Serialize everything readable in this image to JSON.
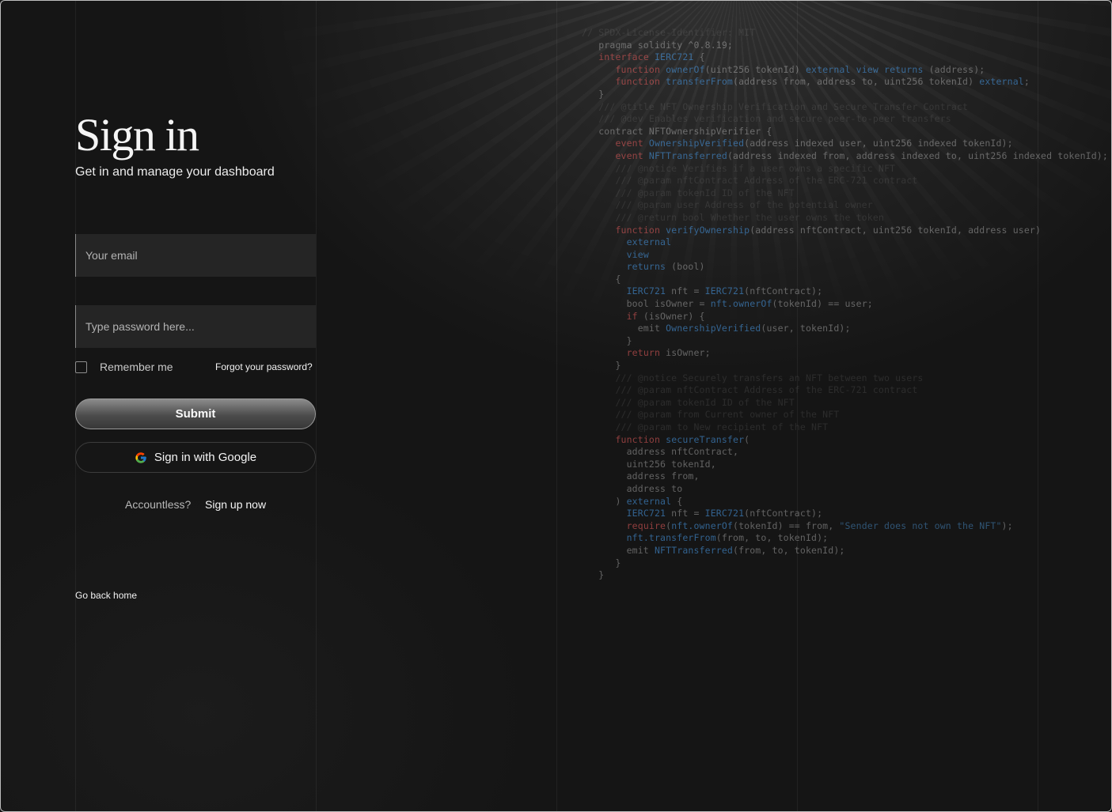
{
  "header": {
    "title": "Sign in",
    "subtitle": "Get in and manage your dashboard"
  },
  "form": {
    "email_placeholder": "Your email",
    "email_value": "",
    "password_placeholder": "Type password here...",
    "password_value": "",
    "remember_label": "Remember me",
    "remember_checked": false,
    "forgot_label": "Forgot your password?",
    "submit_label": "Submit",
    "google_label": "Sign in with Google",
    "google_icon": "google-g-icon"
  },
  "footer": {
    "account_prompt": "Accountless?",
    "signup_label": "Sign up now",
    "back_label": "Go back home"
  },
  "code_lines": [
    "// SPDX-License-Identifier: MIT",
    "pragma solidity ^0.8.19;",
    "interface IERC721 {",
    "function ownerOf(uint256 tokenId) external view returns (address);",
    "function transferFrom(address from, address to, uint256 tokenId) external;",
    "}",
    "/// @title NFT Ownership Verification and Secure Transfer Contract",
    "/// @dev Enables verification and secure peer-to-peer transfers",
    "contract NFTOwnershipVerifier {",
    "event OwnershipVerified(address indexed user, uint256 indexed tokenId);",
    "event NFTTransferred(address indexed from, address indexed to, uint256 indexed tokenId);",
    "/// @notice Verifies if a user owns a specific NFT",
    "/// @param nftContract Address of the ERC-721 contract",
    "/// @param tokenId ID of the NFT",
    "/// @param user Address of the potential owner",
    "/// @return bool Whether the user owns the token",
    "function verifyOwnership(address nftContract, uint256 tokenId, address user)",
    "external",
    "view",
    "returns (bool)",
    "{",
    "IERC721 nft = IERC721(nftContract);",
    "bool isOwner = nft.ownerOf(tokenId) == user;",
    "if (isOwner) {",
    "emit OwnershipVerified(user, tokenId);",
    "}",
    "return isOwner;",
    "}",
    "/// @notice Securely transfers an NFT between two users",
    "/// @param nftContract Address of the ERC-721 contract",
    "/// @param tokenId ID of the NFT",
    "/// @param from Current owner of the NFT",
    "/// @param to New recipient of the NFT",
    "function secureTransfer(",
    "address nftContract,",
    "uint256 tokenId,",
    "address from,",
    "address to",
    ") external {",
    "IERC721 nft = IERC721(nftContract);",
    "require(nft.ownerOf(tokenId) == from, \"Sender does not own the NFT\");",
    "nft.transferFrom(from, to, tokenId);",
    "emit NFTTransferred(from, to, tokenId);",
    "}",
    "}"
  ],
  "colors": {
    "background": "#151515",
    "input_background": "#252525",
    "keyword": "#e15a5a",
    "identifier": "#4696e1"
  }
}
